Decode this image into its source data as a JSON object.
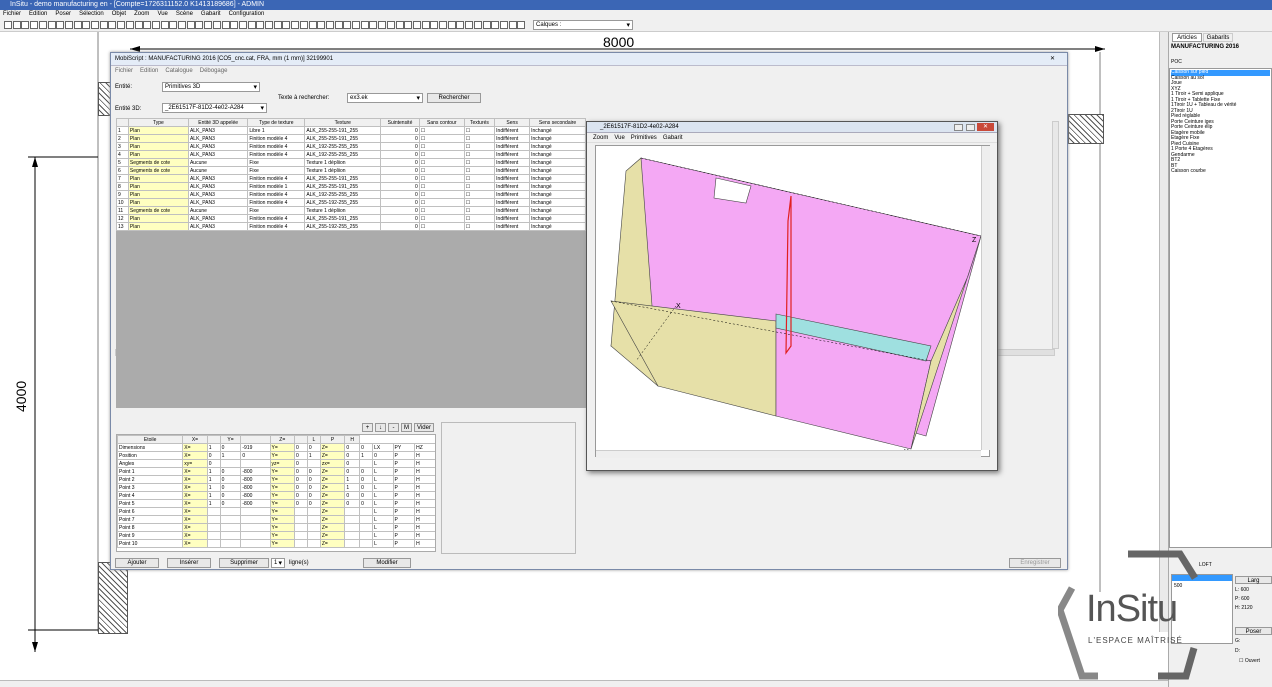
{
  "app": {
    "title": "InSitu - demo manufacturing en - [Compte=1726311152.0 K1413189686] - ADMIN"
  },
  "menu": [
    "Fichier",
    "Edition",
    "Poser",
    "Sélection",
    "Objet",
    "Zoom",
    "Vue",
    "Scène",
    "Gabarit",
    "Configuration"
  ],
  "toolbar": {
    "layers_combo": "Calques :"
  },
  "canvas": {
    "dim_width": "8000",
    "dim_height": "4000"
  },
  "mobiscript": {
    "title": "MobiScript : MANUFACTURING 2016  [CO5_cnc.cat, FRA, mm (1 mm)] 32199901",
    "close": "✕",
    "menu": [
      "Fichier",
      "Edition",
      "Catalogue",
      "Débogage"
    ],
    "entite_label": "Entité:",
    "entite_value": "Primitives 3D",
    "texte_label": "Texte à rechercher:",
    "texte_value": "ex3.ek",
    "rechercher": "Rechercher",
    "entite3d_label": "Entité 3D:",
    "entite3d_value": "_2E61517F-81D2-4e02-A284",
    "columns": [
      "",
      "Type",
      "Entité 3D appelée",
      "Type de texture",
      "Texture",
      "Suintensité",
      "Sans contour",
      "Texturés",
      "Sens",
      "Sens secondaire"
    ],
    "rows": [
      [
        "1",
        "Plan",
        "ALK_PAN3",
        "Libre 1",
        "ALK_255-255-191_255",
        "0",
        "Indifférent",
        "Inchangé"
      ],
      [
        "2",
        "Plan",
        "ALK_PAN3",
        "Finition modèle 4",
        "ALK_255-255-191_255",
        "0",
        "Indifférent",
        "Inchangé"
      ],
      [
        "3",
        "Plan",
        "ALK_PAN3",
        "Finition modèle 4",
        "ALK_192-255-255_255",
        "0",
        "Indifférent",
        "Inchangé"
      ],
      [
        "4",
        "Plan",
        "ALK_PAN3",
        "Finition modèle 4",
        "ALK_192-255-255_255",
        "0",
        "Indifférent",
        "Inchangé"
      ],
      [
        "5",
        "Segments de cote",
        "Aucune",
        "Fixe",
        "Texture 1 dépliion",
        "0",
        "Indifférent",
        "Inchangé"
      ],
      [
        "6",
        "Segments de cote",
        "Aucune",
        "Fixe",
        "Texture 1 dépliion",
        "0",
        "Indifférent",
        "Inchangé"
      ],
      [
        "7",
        "Plan",
        "ALK_PAN3",
        "Finition modèle 4",
        "ALK_255-255-191_255",
        "0",
        "Indifférent",
        "Inchangé"
      ],
      [
        "8",
        "Plan",
        "ALK_PAN3",
        "Finition modèle 1",
        "ALK_255-255-191_255",
        "0",
        "Indifférent",
        "Inchangé"
      ],
      [
        "9",
        "Plan",
        "ALK_PAN3",
        "Finition modèle 4",
        "ALK_192-255-255_255",
        "0",
        "Indifférent",
        "Inchangé"
      ],
      [
        "10",
        "Plan",
        "ALK_PAN3",
        "Finition modèle 4",
        "ALK_255-192-255_255",
        "0",
        "Indifférent",
        "Inchangé"
      ],
      [
        "11",
        "Segments de cote",
        "Aucune",
        "Fixe",
        "Texture 1 dépliion",
        "0",
        "Indifférent",
        "Inchangé"
      ],
      [
        "12",
        "Plan",
        "ALK_PAN3",
        "Finition modèle 4",
        "ALK_255-255-191_255",
        "0",
        "Indifférent",
        "Inchangé"
      ],
      [
        "13",
        "Plan",
        "ALK_PAN3",
        "Finition modèle 4",
        "ALK_255-192-255_255",
        "0",
        "Indifférent",
        "Inchangé"
      ]
    ],
    "sub_buttons": [
      "+",
      "↓",
      "-",
      "M",
      "Vider"
    ],
    "sub_columns": [
      "Etoile",
      "X=",
      "",
      "Y=",
      "",
      "Z=",
      "",
      "L",
      "P",
      "H"
    ],
    "sub_rows": [
      [
        "Dimensions",
        "X=",
        "1",
        "0",
        "-919",
        "Y=",
        "0",
        "0",
        "Z=",
        "0",
        "0",
        "LX",
        "PY",
        "HZ"
      ],
      [
        "Position",
        "X=",
        "0",
        "1",
        "0",
        "Y=",
        "0",
        "1",
        "Z=",
        "0",
        "1",
        "0",
        "P",
        "H"
      ],
      [
        "Angles",
        "xy=",
        "0",
        "",
        "",
        "yz=",
        "0",
        "",
        "zx=",
        "0",
        "",
        "L",
        "P",
        "H"
      ],
      [
        "Point 1",
        "X=",
        "1",
        "0",
        "-800",
        "Y=",
        "0",
        "0",
        "Z=",
        "0",
        "0",
        "L",
        "P",
        "H"
      ],
      [
        "Point 2",
        "X=",
        "1",
        "0",
        "-800",
        "Y=",
        "0",
        "0",
        "Z=",
        "1",
        "0",
        "L",
        "P",
        "H"
      ],
      [
        "Point 3",
        "X=",
        "1",
        "0",
        "-800",
        "Y=",
        "0",
        "0",
        "Z=",
        "1",
        "0",
        "L",
        "P",
        "H"
      ],
      [
        "Point 4",
        "X=",
        "1",
        "0",
        "-800",
        "Y=",
        "0",
        "0",
        "Z=",
        "0",
        "0",
        "L",
        "P",
        "H"
      ],
      [
        "Point 5",
        "X=",
        "1",
        "0",
        "-800",
        "Y=",
        "0",
        "0",
        "Z=",
        "0",
        "0",
        "L",
        "P",
        "H"
      ],
      [
        "Point 6",
        "X=",
        "",
        "",
        "",
        "Y=",
        "",
        "",
        "Z=",
        "",
        "",
        "L",
        "P",
        "H"
      ],
      [
        "Point 7",
        "X=",
        "",
        "",
        "",
        "Y=",
        "",
        "",
        "Z=",
        "",
        "",
        "L",
        "P",
        "H"
      ],
      [
        "Point 8",
        "X=",
        "",
        "",
        "",
        "Y=",
        "",
        "",
        "Z=",
        "",
        "",
        "L",
        "P",
        "H"
      ],
      [
        "Point 9",
        "X=",
        "",
        "",
        "",
        "Y=",
        "",
        "",
        "Z=",
        "",
        "",
        "L",
        "P",
        "H"
      ],
      [
        "Point 10",
        "X=",
        "",
        "",
        "",
        "Y=",
        "",
        "",
        "Z=",
        "",
        "",
        "L",
        "P",
        "H"
      ]
    ],
    "bottom": {
      "ajouter": "Ajouter",
      "inserer": "Insérer",
      "supprimer": "Supprimer",
      "count": "1",
      "lignes": "ligne(s)",
      "modifier": "Modifier",
      "enregistrer": "Enregistrer"
    }
  },
  "viewer": {
    "title": "_2E61517F-81D2-4e02-A284",
    "menu": [
      "Zoom",
      "Vue",
      "Primitives",
      "Gabarit"
    ],
    "axes": {
      "x": "X",
      "y": "Y",
      "z": "Z"
    }
  },
  "right_panel": {
    "tabs": [
      "Articles",
      "Gabarits"
    ],
    "header": "MANUFACTURING 2016",
    "sub": "POC",
    "items": [
      "Caisson sur pied",
      "Caisson au sol",
      "Joue",
      "XYZ",
      "1 Tiroir + Semi applique",
      "1 Tiroir + Tablette Fixe",
      "1Tiroir 1U + Tableau de vérité",
      "2Tiroir 1U",
      "Pied réglable",
      "Porte Ceinture iges",
      "Porte Ceinture élip",
      "Etagère mobile",
      "Etagère Fixe",
      "Pied Cuisine",
      "1 Porte 4 Etagères",
      "Gendarme",
      "BT2",
      "BT",
      "Caisson courbe"
    ],
    "footer_label": "LOFT",
    "larg": "Larg",
    "L": "L:",
    "L_val": "600",
    "P": "P:",
    "P_val": "600",
    "H": "H:",
    "H_val": "2120",
    "poser": "Poser",
    "ouvert": "Ouvert",
    "G": "G:",
    "D": "D:",
    "val500": "500"
  },
  "logo": {
    "name": "InSitu",
    "tagline": "L'ESPACE MAÎTRISÉ"
  },
  "colors": {
    "pink": "#f4a8f4",
    "beige": "#e6e0a8",
    "cyan": "#9fe0e0",
    "red": "#e02020",
    "titlebar": "#3b66b5"
  }
}
